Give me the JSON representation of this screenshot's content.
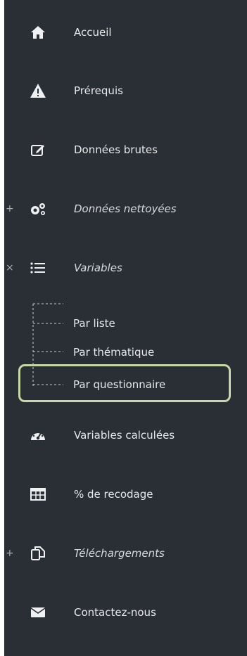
{
  "sidebar": {
    "items": [
      {
        "label": "Accueil",
        "icon": "home-icon"
      },
      {
        "label": "Prérequis",
        "icon": "warning-icon"
      },
      {
        "label": "Données brutes",
        "icon": "edit-icon"
      },
      {
        "label": "Données nettoyées",
        "icon": "gears-icon",
        "marker": "+"
      },
      {
        "label": "Variables",
        "icon": "list-icon",
        "marker": "×"
      },
      {
        "label": "Variables calculées",
        "icon": "dashboard-icon"
      },
      {
        "label": "% de recodage",
        "icon": "table-icon"
      },
      {
        "label": "Téléchargements",
        "icon": "copy-icon",
        "marker": "+"
      },
      {
        "label": "Contactez-nous",
        "icon": "mail-icon"
      }
    ],
    "variables_children": [
      {
        "label": "Par liste"
      },
      {
        "label": "Par thématique"
      },
      {
        "label": "Par questionnaire"
      }
    ]
  },
  "colors": {
    "sidebar_bg": "#2a2f35",
    "text": "#e7e9eb",
    "highlight_border": "#c8d7a7"
  }
}
